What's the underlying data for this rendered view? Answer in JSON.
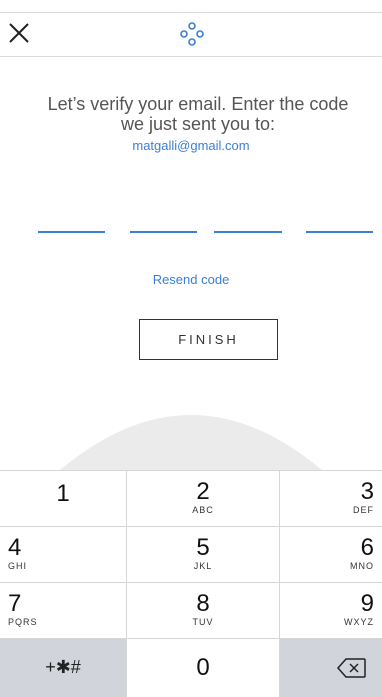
{
  "message": {
    "line1": "Let’s verify your email. Enter the code",
    "line2": "we just sent you to:",
    "email": "matgalli@gmail.com"
  },
  "resend_label": "Resend code",
  "finish_label": "FINISH",
  "code_fields": [
    "",
    "",
    "",
    ""
  ],
  "keypad": {
    "keys": [
      {
        "num": "1",
        "letters": ""
      },
      {
        "num": "2",
        "letters": "ABC"
      },
      {
        "num": "3",
        "letters": "DEF"
      },
      {
        "num": "4",
        "letters": "GHI"
      },
      {
        "num": "5",
        "letters": "JKL"
      },
      {
        "num": "6",
        "letters": "MNO"
      },
      {
        "num": "7",
        "letters": "PQRS"
      },
      {
        "num": "8",
        "letters": "TUV"
      },
      {
        "num": "9",
        "letters": "WXYZ"
      },
      {
        "num": "+✱#",
        "letters": ""
      },
      {
        "num": "0",
        "letters": ""
      },
      {
        "num": "",
        "letters": ""
      }
    ]
  },
  "icons": {
    "close": "close-icon",
    "logo": "dots-logo-icon",
    "backspace": "backspace-icon"
  },
  "colors": {
    "accent": "#3a7fd5",
    "text": "#555555",
    "key_gray": "#d1d5db"
  }
}
